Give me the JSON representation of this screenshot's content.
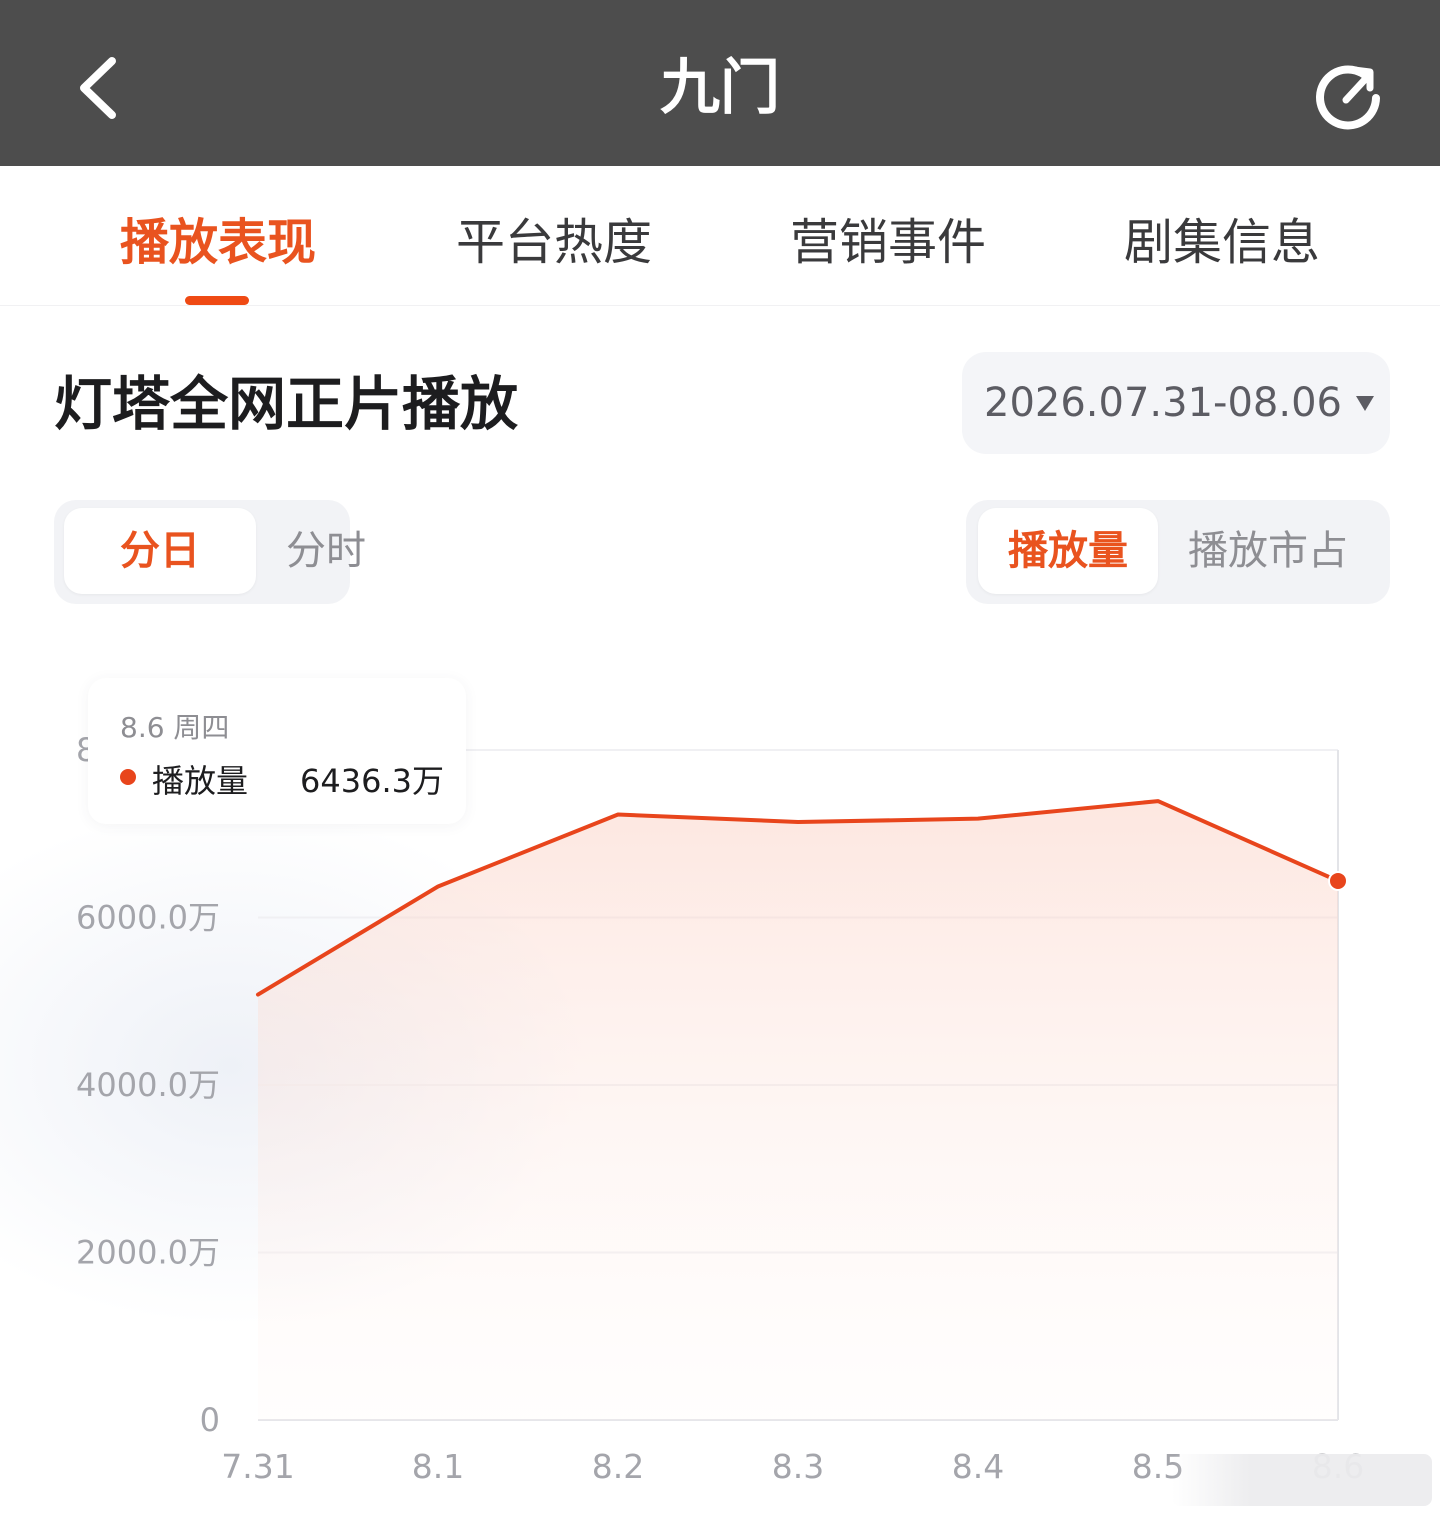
{
  "header": {
    "title": "九门",
    "back_icon": "chevron-left-icon",
    "refresh_icon": "refresh-icon"
  },
  "tabs": [
    {
      "label": "播放表现",
      "active": true
    },
    {
      "label": "平台热度",
      "active": false
    },
    {
      "label": "营销事件",
      "active": false
    },
    {
      "label": "剧集信息",
      "active": false
    }
  ],
  "section": {
    "title": "灯塔全网正片播放",
    "date_range": "2026.07.31-08.06"
  },
  "granularity": {
    "options": [
      "分日",
      "分时"
    ],
    "selected": "分日"
  },
  "metric": {
    "options": [
      "播放量",
      "播放市占"
    ],
    "selected": "播放量"
  },
  "tooltip": {
    "date": "8.6 周四",
    "series": "播放量",
    "value": "6436.3万"
  },
  "colors": {
    "accent": "#e9531f",
    "line": "#e8451c",
    "topbar": "#4d4d4d"
  },
  "chart_data": {
    "type": "area",
    "x": [
      "7.31",
      "8.1",
      "8.2",
      "8.3",
      "8.4",
      "8.5",
      "8.6"
    ],
    "series": [
      {
        "name": "播放量",
        "values": [
          5080,
          6370,
          7230,
          7140,
          7180,
          7390,
          6436.3
        ]
      }
    ],
    "y_ticks": [
      "0",
      "2000.0万",
      "4000.0万",
      "6000.0万",
      "8000.0万"
    ],
    "ylim": [
      0,
      8000
    ],
    "y_unit": "万",
    "grid": true,
    "highlight_index": 6
  }
}
